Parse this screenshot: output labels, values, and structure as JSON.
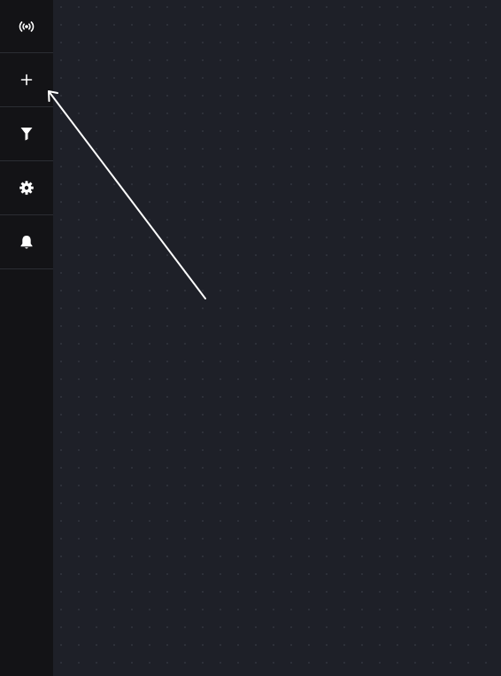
{
  "sidebar": {
    "items": [
      {
        "icon": "broadcast-icon",
        "action": "live"
      },
      {
        "icon": "plus-icon",
        "action": "add"
      },
      {
        "icon": "filter-icon",
        "action": "filter"
      },
      {
        "icon": "gear-icon",
        "action": "settings"
      },
      {
        "icon": "bell-icon",
        "action": "notifications"
      }
    ]
  },
  "canvas": {
    "background": "#1e2028",
    "grid": "dotted"
  },
  "colors": {
    "sidebar_bg": "#131316",
    "canvas_bg": "#1e2028",
    "icon": "#ffffff",
    "annotation_arrow": "#ffffff"
  }
}
